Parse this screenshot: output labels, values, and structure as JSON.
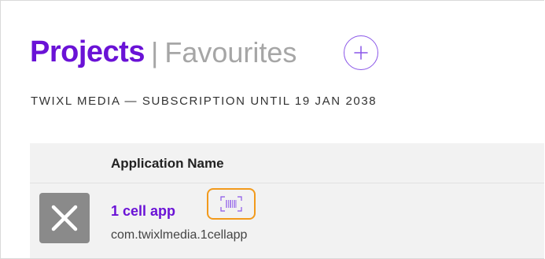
{
  "header": {
    "title_active": "Projects",
    "separator": "|",
    "title_inactive": "Favourites",
    "add_button_icon": "plus-circle-icon"
  },
  "subtitle": "TWIXL MEDIA — SUBSCRIPTION UNTIL 19 JAN 2038",
  "table": {
    "columns": [
      "Application Name"
    ],
    "rows": [
      {
        "thumbnail_icon": "x-icon",
        "app_name": "1 cell app",
        "bundle_id": "com.twixlmedia.1cellapp",
        "action_icon": "barcode-scan-icon"
      }
    ]
  },
  "colors": {
    "accent": "#6a12d6",
    "muted": "#a6a6a6",
    "highlight": "#f29a1c",
    "thumbnail_bg": "#8a8a8a",
    "table_bg": "#f2f2f2"
  }
}
